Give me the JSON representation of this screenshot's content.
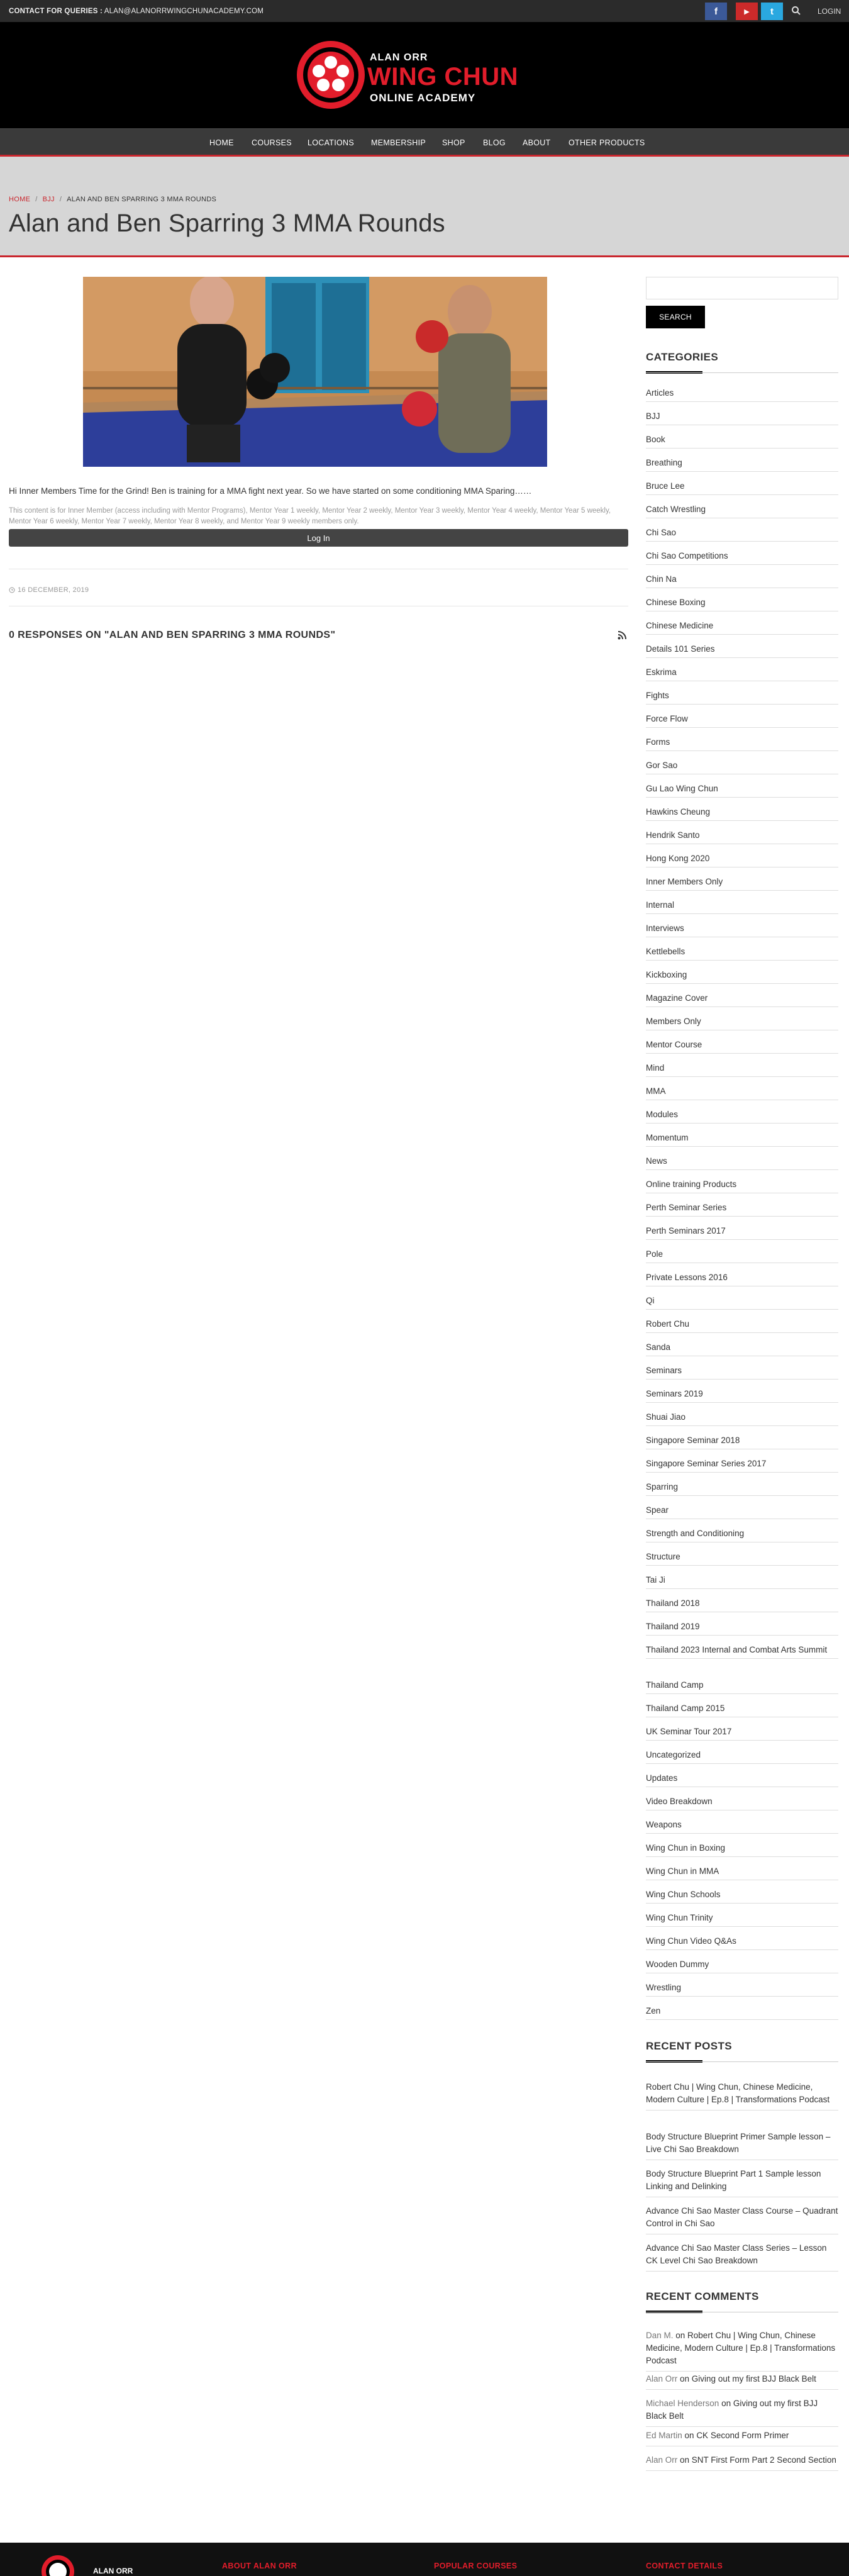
{
  "topbar": {
    "contact_label": "CONTACT FOR QUERIES :",
    "contact_email": "ALAN@ALANORRWINGCHUNACADEMY.COM",
    "social": [
      {
        "icon": "facebook-icon",
        "glyph": "f",
        "color": "#3b5998"
      },
      {
        "icon": "youtube-icon",
        "glyph": "▶",
        "color": "#cc2a2a"
      },
      {
        "icon": "twitter-icon",
        "glyph": "t",
        "color": "#2aa8e0"
      }
    ],
    "login": "LOGIN"
  },
  "logo": {
    "line1": "ALAN ORR",
    "line2": "WING CHUN",
    "line3": "ONLINE ACADEMY"
  },
  "nav": {
    "items": [
      "HOME",
      "COURSES",
      "LOCATIONS",
      "MEMBERSHIP",
      "SHOP",
      "BLOG",
      "ABOUT",
      "OTHER PRODUCTS"
    ]
  },
  "breadcrumb": {
    "home": "HOME",
    "category": "BJJ",
    "current": "ALAN AND BEN SPARRING 3 MMA ROUNDS"
  },
  "page_title": "Alan and Ben Sparring 3 MMA Rounds",
  "post": {
    "intro": "Hi Inner Members Time for the Grind! Ben is training for a MMA fight next year. So we have started on some conditioning MMA Sparing……",
    "restricted": "This content is for Inner Member (access including with Mentor Programs), Mentor Year 1 weekly, Mentor Year 2 weekly, Mentor Year 3 weekly, Mentor Year 4 weekly, Mentor Year 5 weekly, Mentor Year 6 weekly, Mentor Year 7 weekly, Mentor Year 8 weekly, and Mentor Year 9 weekly members only.",
    "login_button": "Log In",
    "date": "16 DECEMBER, 2019",
    "responses": "0 RESPONSES ON \"ALAN AND BEN SPARRING 3 MMA ROUNDS\""
  },
  "sidebar": {
    "search_placeholder": "",
    "search_button": "SEARCH",
    "categories_heading": "CATEGORIES",
    "categories": [
      "Articles",
      "BJJ",
      "Book",
      "Breathing",
      "Bruce Lee",
      "Catch Wrestling",
      "Chi Sao",
      "Chi Sao Competitions",
      "Chin Na",
      "Chinese Boxing",
      "Chinese Medicine",
      "Details 101 Series",
      "Eskrima",
      "Fights",
      "Force Flow",
      "Forms",
      "Gor Sao",
      "Gu Lao Wing Chun",
      "Hawkins Cheung",
      "Hendrik Santo",
      "Hong Kong 2020",
      "Inner Members Only",
      "Internal",
      "Interviews",
      "Kettlebells",
      "Kickboxing",
      "Magazine Cover",
      "Members Only",
      "Mentor Course",
      "Mind",
      "MMA",
      "Modules",
      "Momentum",
      "News",
      "Online training Products",
      "Perth Seminar Series",
      "Perth Seminars 2017",
      "Pole",
      "Private Lessons 2016",
      "Qi",
      "Robert Chu",
      "Sanda",
      "Seminars",
      "Seminars 2019",
      "Shuai Jiao",
      "Singapore Seminar 2018",
      "Singapore Seminar Series 2017",
      "Sparring",
      "Spear",
      "Strength and Conditioning",
      "Structure",
      "Tai Ji",
      "Thailand 2018",
      "Thailand 2019",
      "Thailand 2023 Internal and Combat Arts Summit",
      "Thailand Camp",
      "Thailand Camp 2015",
      "UK Seminar Tour 2017",
      "Uncategorized",
      "Updates",
      "Video Breakdown",
      "Weapons",
      "Wing Chun in Boxing",
      "Wing Chun in MMA",
      "Wing Chun Schools",
      "Wing Chun Trinity",
      "Wing Chun Video Q&As",
      "Wooden Dummy",
      "Wrestling",
      "Zen"
    ],
    "recent_posts_heading": "RECENT POSTS",
    "recent_posts": [
      "Robert Chu | Wing Chun, Chinese Medicine, Modern Culture | Ep.8 | Transformations Podcast",
      "Body Structure Blueprint Primer Sample lesson – Live Chi Sao Breakdown",
      "Body Structure Blueprint Part 1 Sample lesson Linking and Delinking",
      "Advance Chi Sao Master Class Course – Quadrant Control in Chi Sao",
      "Advance Chi Sao Master Class Series – Lesson CK Level Chi Sao Breakdown"
    ],
    "recent_comments_heading": "RECENT COMMENTS",
    "recent_comments": [
      {
        "author": "Dan M.",
        "on": " on ",
        "post": "Robert Chu | Wing Chun, Chinese Medicine, Modern Culture | Ep.8 | Transformations Podcast"
      },
      {
        "author": "Alan Orr",
        "on": " on ",
        "post": "Giving out my first BJJ Black Belt"
      },
      {
        "author": "Michael Henderson",
        "on": " on ",
        "post": "Giving out my first BJJ Black Belt"
      },
      {
        "author": "Ed Martin",
        "on": " on ",
        "post": "CK Second Form Primer"
      },
      {
        "author": "Alan Orr",
        "on": " on ",
        "post": "SNT First Form Part 2 Second Section"
      }
    ]
  },
  "footer": {
    "logo_text": "ALAN ORR",
    "col1": "ABOUT ALAN ORR",
    "col2": "POPULAR COURSES",
    "col3": "CONTACT DETAILS"
  }
}
